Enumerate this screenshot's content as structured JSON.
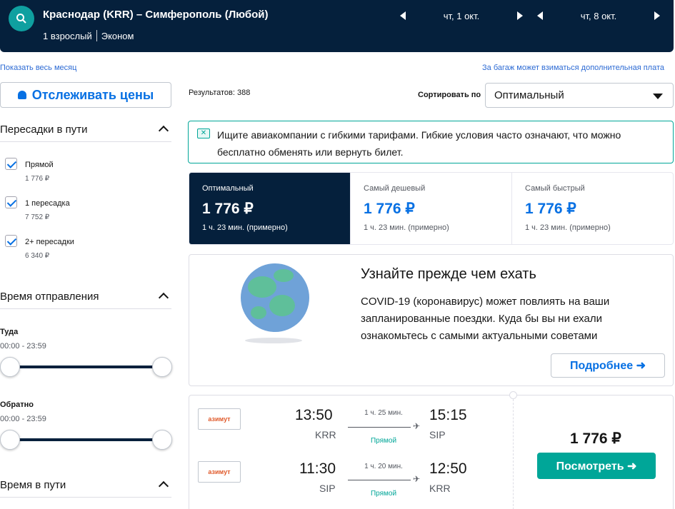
{
  "header": {
    "route": "Краснодар (KRR) – Симферополь (Любой)",
    "passengers": "1 взрослый",
    "cabin": "Эконом",
    "depart_date": "чт, 1 окт.",
    "return_date": "чт, 8 окт."
  },
  "links": {
    "show_month": "Показать весь месяц",
    "baggage_note": "За багаж может взиматься дополнительная плата"
  },
  "sidebar": {
    "track_prices": "Отслеживать цены",
    "stops_title": "Пересадки в пути",
    "stops": [
      {
        "label": "Прямой",
        "price": "1 776 ₽",
        "checked": true
      },
      {
        "label": "1 пересадка",
        "price": "7 752 ₽",
        "checked": true
      },
      {
        "label": "2+ пересадки",
        "price": "6 340 ₽",
        "checked": true
      }
    ],
    "departure_title": "Время отправления",
    "outbound_label": "Туда",
    "outbound_range": "00:00 - 23:59",
    "return_label": "Обратно",
    "return_range": "00:00 - 23:59",
    "duration_title": "Время в пути"
  },
  "results": {
    "count": "Результатов: 388",
    "sort_label": "Сортировать по",
    "sort_value": "Оптимальный"
  },
  "banner": {
    "text": "Ищите авиакомпании с гибкими тарифами. Гибкие условия часто означают, что можно бесплатно обменять или вернуть билет."
  },
  "tabs": [
    {
      "name": "Оптимальный",
      "price": "1 776 ₽",
      "duration": "1 ч. 23 мин. (примерно)",
      "active": true
    },
    {
      "name": "Самый дешевый",
      "price": "1 776 ₽",
      "duration": "1 ч. 23 мин. (примерно)",
      "active": false
    },
    {
      "name": "Самый быстрый",
      "price": "1 776 ₽",
      "duration": "1 ч. 23 мин. (примерно)",
      "active": false
    }
  ],
  "covid": {
    "title": "Узнайте прежде чем ехать",
    "body": "COVID-19 (коронавирус) может повлиять на ваши запланированные поездки. Куда бы вы ни ехали ознакомьтесь с самыми актуальными советами",
    "button": "Подробнее ➜"
  },
  "flight": {
    "airline": "азимут",
    "outbound": {
      "dep_time": "13:50",
      "dep_code": "KRR",
      "arr_time": "15:15",
      "arr_code": "SIP",
      "duration": "1 ч. 25 мин.",
      "stops": "Прямой"
    },
    "inbound": {
      "dep_time": "11:30",
      "dep_code": "SIP",
      "arr_time": "12:50",
      "arr_code": "KRR",
      "duration": "1 ч. 20 мин.",
      "stops": "Прямой"
    },
    "price": "1 776 ₽",
    "view_button": "Посмотреть ➜"
  },
  "colors": {
    "navy": "#05203c",
    "teal": "#00a698",
    "blue": "#0770e3"
  }
}
